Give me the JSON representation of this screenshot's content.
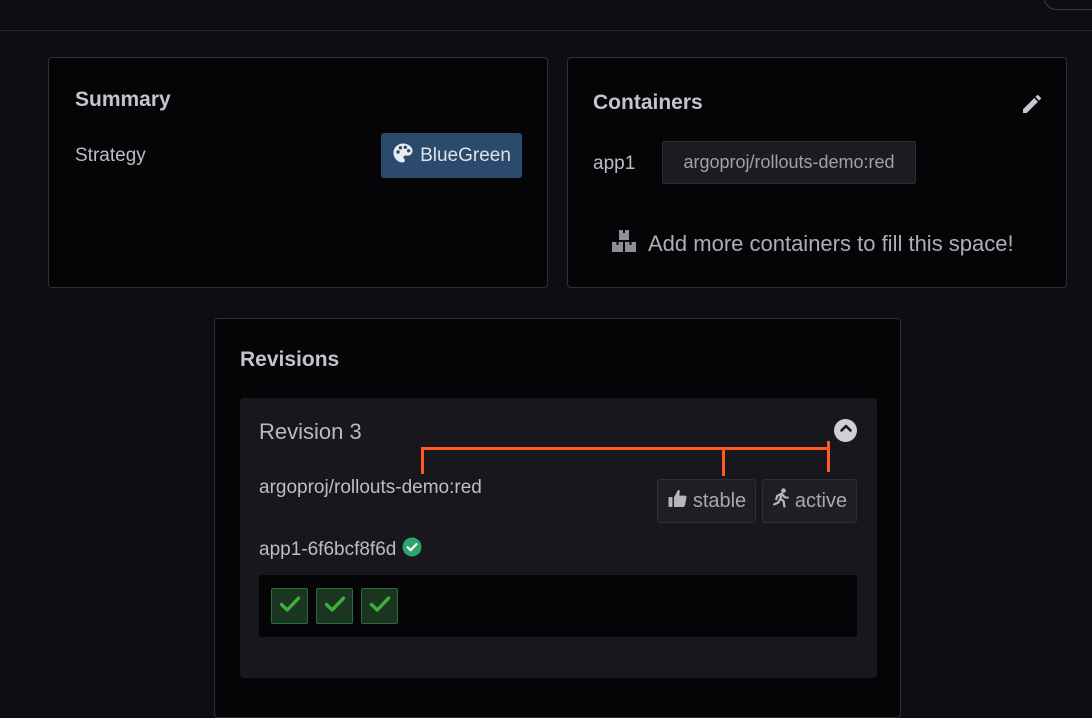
{
  "summary": {
    "title": "Summary",
    "strategy_label": "Strategy",
    "strategy_value": "BlueGreen",
    "strategy_icon": "palette-icon"
  },
  "containers": {
    "title": "Containers",
    "edit_icon": "pencil-icon",
    "items": [
      {
        "name": "app1",
        "image": "argoproj/rollouts-demo:red"
      }
    ],
    "add_more_text": "Add more containers to fill this space!",
    "add_more_icon": "boxes-icon"
  },
  "revisions": {
    "title": "Revisions",
    "items": [
      {
        "title": "Revision 3",
        "image": "argoproj/rollouts-demo:red",
        "tags": [
          {
            "label": "stable",
            "icon": "thumbs-up-icon"
          },
          {
            "label": "active",
            "icon": "running-icon"
          }
        ],
        "replicaset": "app1-6f6bcf8f6d",
        "replicaset_status": "healthy",
        "pods": [
          {
            "status": "ok"
          },
          {
            "status": "ok"
          },
          {
            "status": "ok"
          }
        ]
      }
    ]
  },
  "colors": {
    "background": "#0e0e12",
    "panel": "#050507",
    "strategy_badge": "#2c4a6b",
    "success_green": "#2fa36b",
    "pod_check": "#3fae3f",
    "annotation_orange": "#ff5b1f"
  }
}
